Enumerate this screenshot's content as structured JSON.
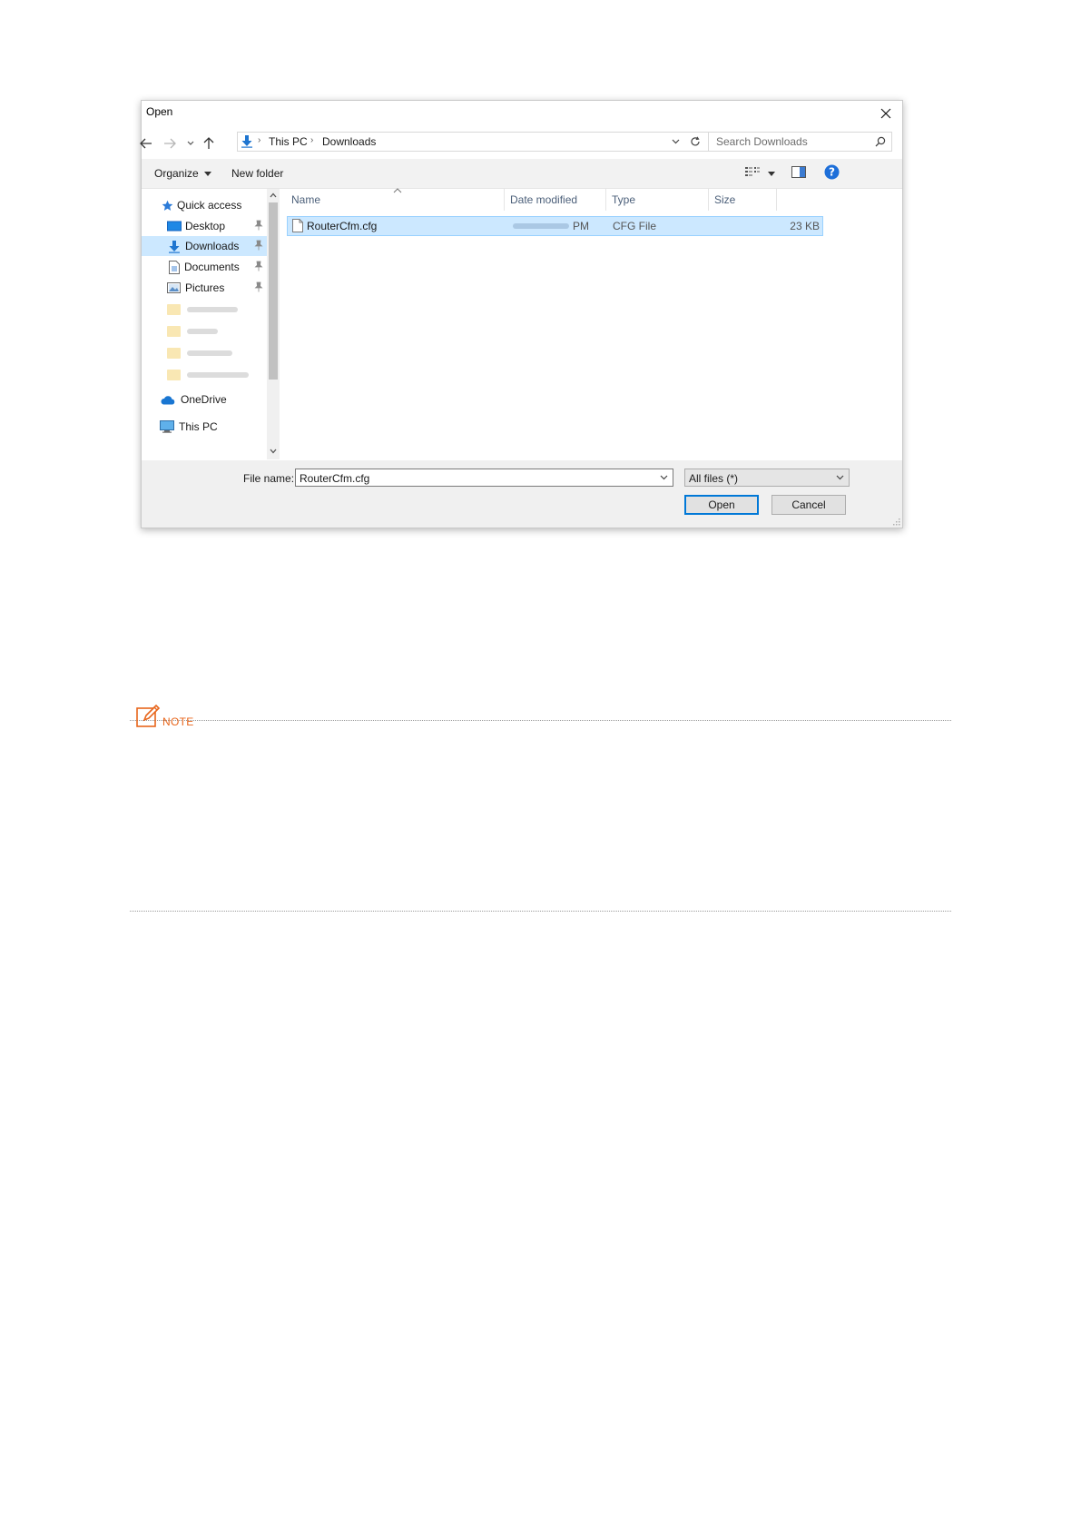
{
  "dialog": {
    "title": "Open",
    "address": {
      "crumbs": [
        "This PC",
        "Downloads"
      ]
    },
    "search_placeholder": "Search Downloads",
    "toolbar": {
      "organize": "Organize",
      "new_folder": "New folder"
    },
    "nav": {
      "quick_access": "Quick access",
      "items": [
        "Desktop",
        "Downloads",
        "Documents",
        "Pictures"
      ],
      "onedrive": "OneDrive",
      "this_pc": "This PC"
    },
    "columns": {
      "name": "Name",
      "date": "Date modified",
      "type": "Type",
      "size": "Size"
    },
    "file": {
      "name": "RouterCfm.cfg",
      "date_suffix": "PM",
      "type": "CFG File",
      "size": "23 KB"
    },
    "filename_label": "File name:",
    "filename_value": "RouterCfm.cfg",
    "filetype_value": "All files (*)",
    "open_label": "Open",
    "cancel_label": "Cancel"
  },
  "note": {
    "label": "NOTE"
  },
  "colors": {
    "accent": "#0078d7",
    "selection": "#cce8ff",
    "note": "#e8661c"
  }
}
